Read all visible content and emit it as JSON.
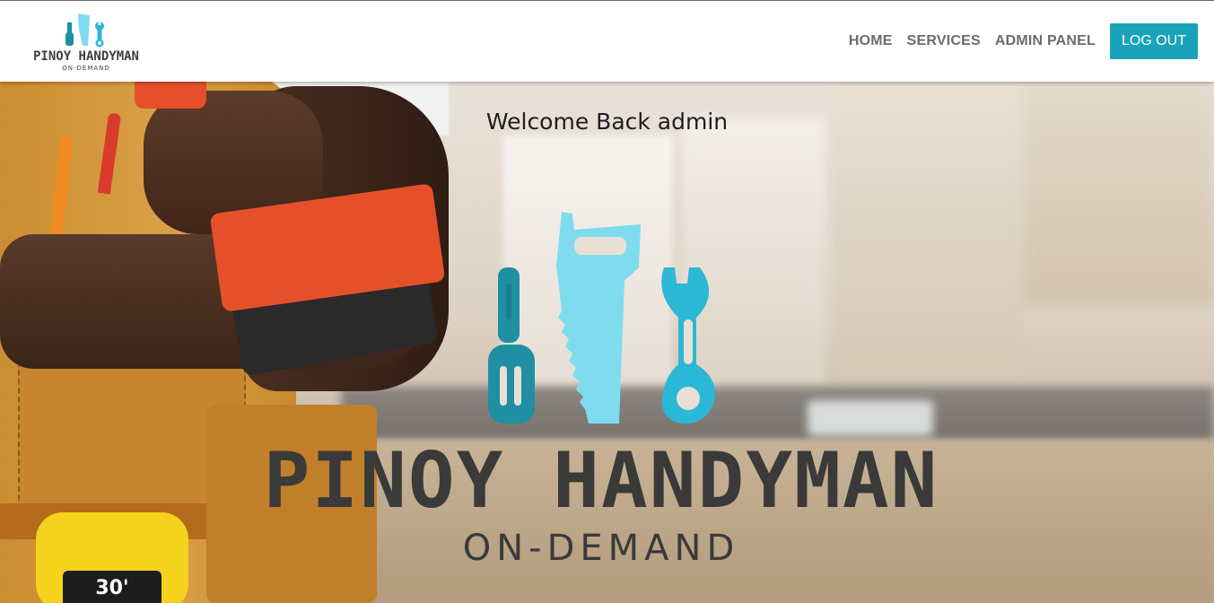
{
  "brand": {
    "name": "PINOY HANDYMAN",
    "subtitle": "ON-DEMAND",
    "icon": "tools-logo-icon"
  },
  "nav": {
    "items": [
      {
        "label": "HOME"
      },
      {
        "label": "SERVICES"
      },
      {
        "label": "ADMIN PANEL"
      }
    ],
    "logout_label": "LOG OUT"
  },
  "hero": {
    "welcome": "Welcome Back admin",
    "logo_name": "PINOY HANDYMAN",
    "logo_subtitle": "ON-DEMAND",
    "tape_label": "30'"
  },
  "colors": {
    "accent": "#1aa3b8",
    "screwdriver": "#1f8fa3",
    "saw": "#7fdcef",
    "wrench": "#2bb8d6",
    "logo_text": "#3a3a3a"
  }
}
